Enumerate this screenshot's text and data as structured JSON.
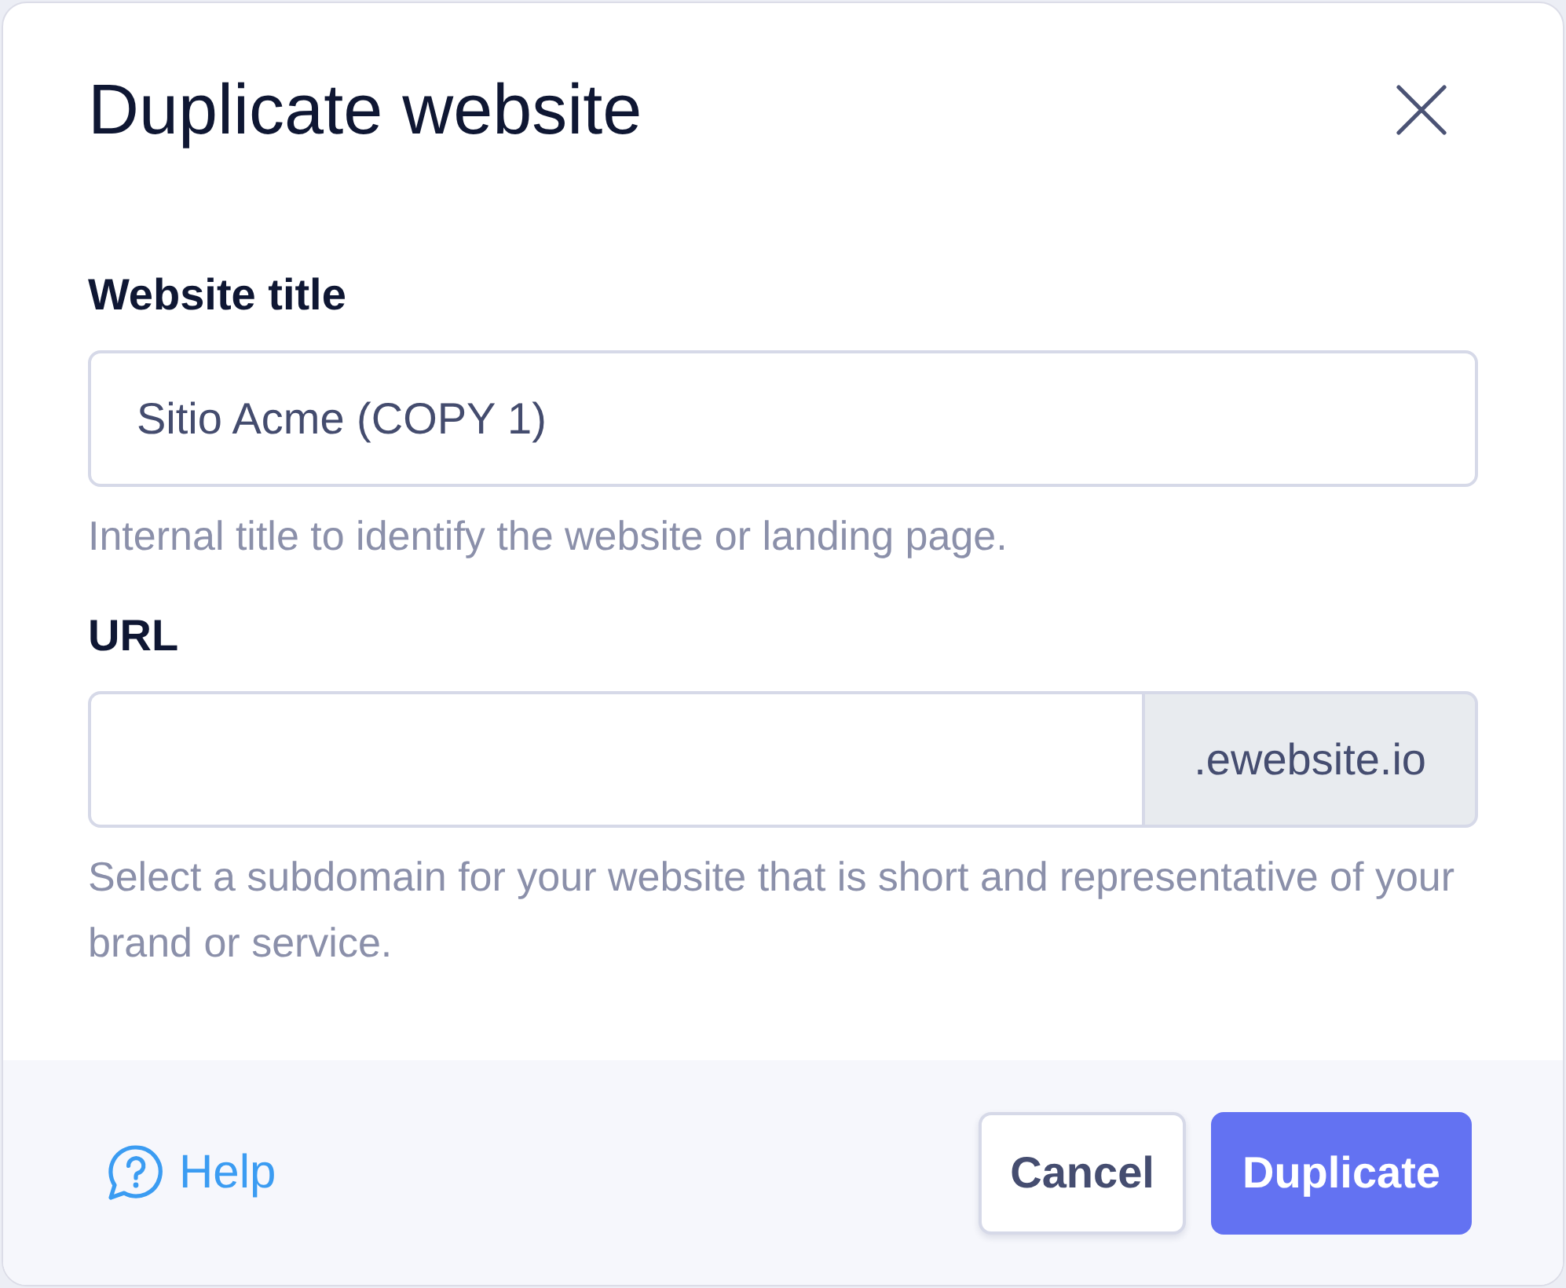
{
  "dialog": {
    "title": "Duplicate website"
  },
  "fields": [
    {
      "kind": "text",
      "label": "Website title",
      "value": "Sitio Acme (COPY 1)",
      "help": "Internal title to identify the website or landing page."
    },
    {
      "kind": "suffixed",
      "label": "URL",
      "suffix": ".ewebsite.io",
      "help": "Select a subdomain for your website that is short and representative of your brand or service."
    }
  ],
  "footer": {
    "help_link": "Help",
    "buttons": [
      {
        "label": "Cancel",
        "kind": "secondary"
      },
      {
        "label": "Duplicate",
        "kind": "primary"
      }
    ]
  }
}
